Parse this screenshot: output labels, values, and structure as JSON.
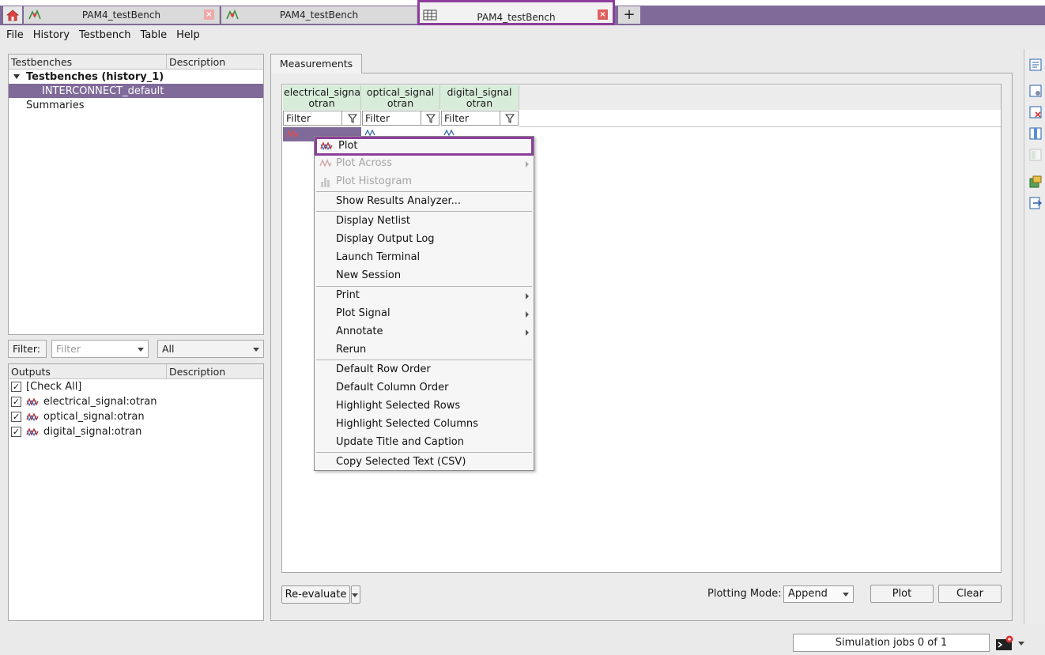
{
  "tabs": [
    {
      "title": "PAM4_testBench",
      "close": "×"
    },
    {
      "title": "PAM4_testBench"
    },
    {
      "title": "PAM4_testBench",
      "close": "×"
    }
  ],
  "add_tab_label": "+",
  "menu": [
    "File",
    "History",
    "Testbench",
    "Table",
    "Help"
  ],
  "testbench_panel": {
    "columns": [
      "Testbenches",
      "Description"
    ],
    "root": "Testbenches (history_1)",
    "selected_item": "INTERCONNECT_default",
    "summaries": "Summaries"
  },
  "filter_bar": {
    "filter_button": "Filter:",
    "filter_placeholder": "Filter",
    "scope_value": "All"
  },
  "outputs_panel": {
    "columns": [
      "Outputs",
      "Description"
    ],
    "check_all": "[Check All]",
    "items": [
      "electrical_signal:otran",
      "optical_signal:otran",
      "digital_signal:otran"
    ],
    "check_mark": "✓"
  },
  "measurements": {
    "tab_label": "Measurements",
    "columns": [
      {
        "line1": "electrical_signa",
        "line2": "otran"
      },
      {
        "line1": "optical_signal",
        "line2": "otran"
      },
      {
        "line1": "digital_signal",
        "line2": "otran"
      }
    ],
    "filter_value": "Filter"
  },
  "context_menu": {
    "plot": "Plot",
    "plot_across": "Plot Across",
    "plot_histogram": "Plot Histogram",
    "show_results_analyzer": "Show Results Analyzer...",
    "display_netlist": "Display Netlist",
    "display_output_log": "Display Output Log",
    "launch_terminal": "Launch Terminal",
    "new_session": "New Session",
    "print": "Print",
    "plot_signal": "Plot Signal",
    "annotate": "Annotate",
    "rerun": "Rerun",
    "default_row_order": "Default Row Order",
    "default_column_order": "Default Column Order",
    "highlight_selected_rows": "Highlight Selected Rows",
    "highlight_selected_columns": "Highlight Selected Columns",
    "update_title_caption": "Update Title and Caption",
    "copy_selected_text": "Copy Selected Text (CSV)"
  },
  "bottom_bar": {
    "reevaluate": "Re-evaluate",
    "plotting_mode_label": "Plotting Mode:",
    "plotting_mode_value": "Append",
    "plot_button": "Plot",
    "clear_button": "Clear"
  },
  "status": {
    "sim_jobs": "Simulation jobs 0 of 1"
  },
  "colors": {
    "accent": "#8d3e9b",
    "selection": "#7f6a99",
    "header_green": "#d7ecd9"
  }
}
